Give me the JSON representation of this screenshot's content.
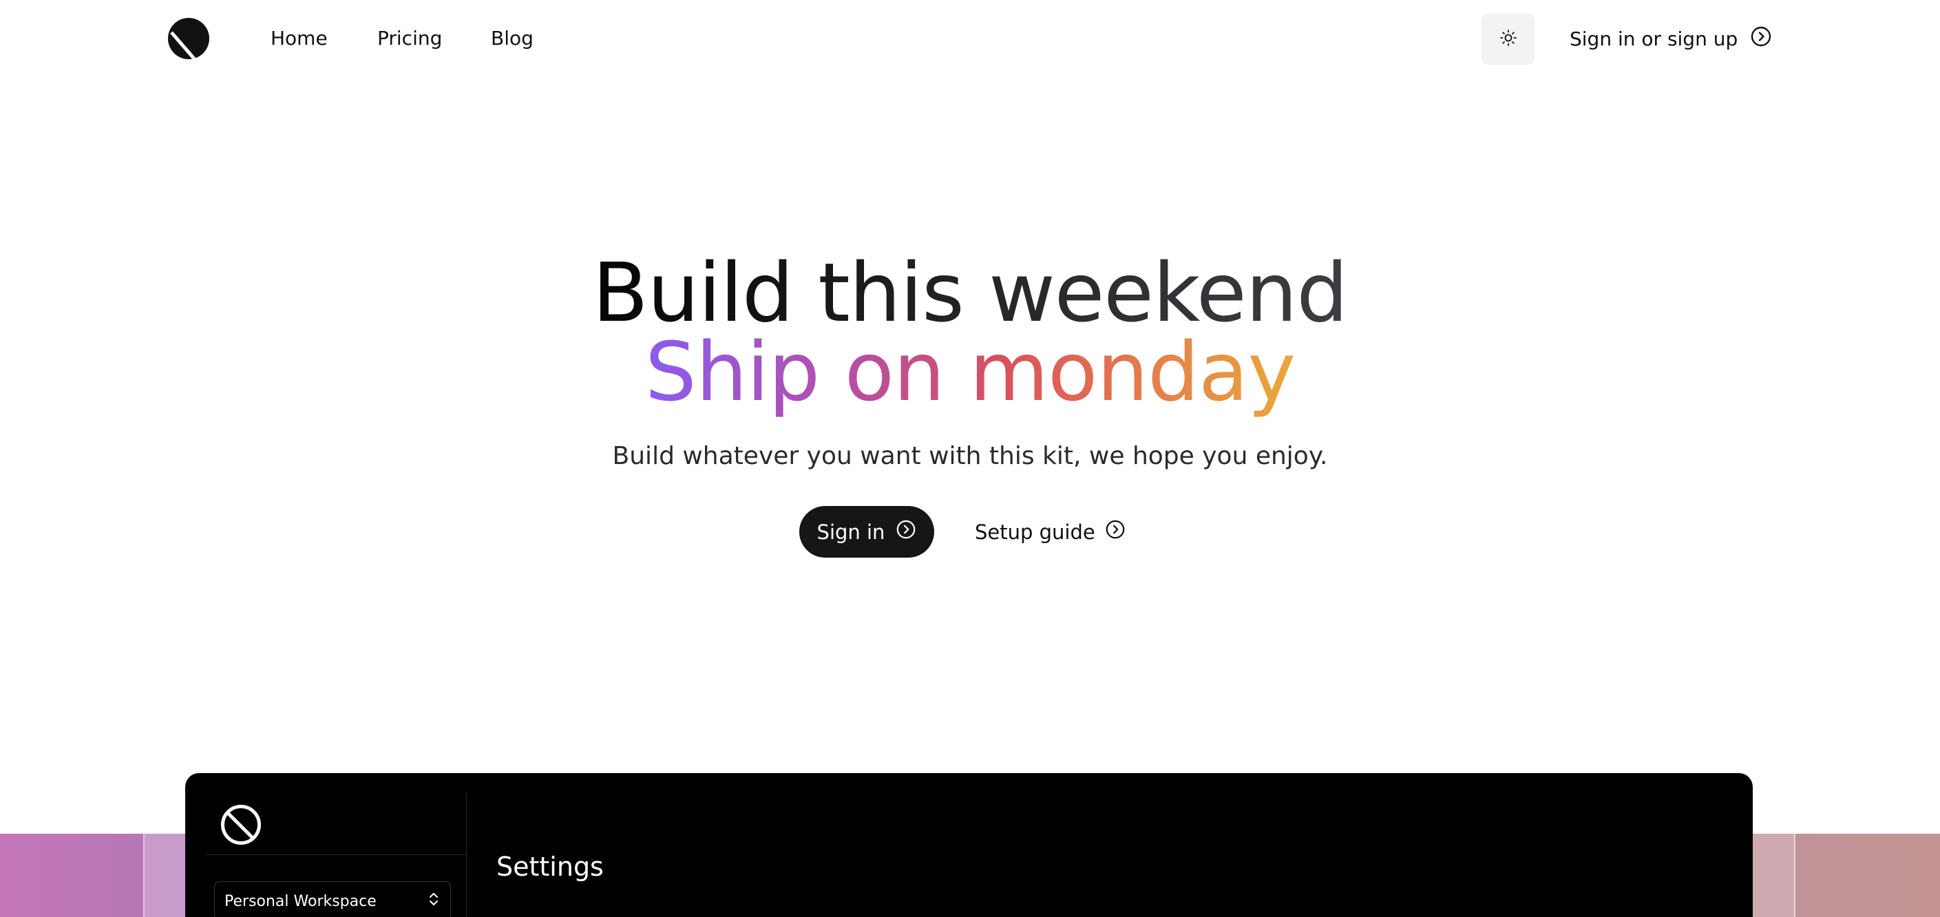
{
  "header": {
    "logo": {
      "icon": "half-moon-slash-logo-icon"
    },
    "nav": [
      {
        "label": "Home"
      },
      {
        "label": "Pricing"
      },
      {
        "label": "Blog"
      }
    ],
    "theme_toggle": {
      "icon": "sun-icon"
    },
    "auth_link": {
      "label": "Sign in or sign up",
      "icon": "chevron-right-circle-icon"
    }
  },
  "hero": {
    "line1": "Build this weekend",
    "line2": "Ship on monday",
    "subtitle": "Build whatever you want with this kit, we hope you enjoy.",
    "primary_cta": {
      "label": "Sign in",
      "icon": "chevron-right-circle-icon"
    },
    "secondary_cta": {
      "label": "Setup guide",
      "icon": "chevron-right-circle-icon"
    }
  },
  "preview": {
    "logo": {
      "icon": "circle-slash-logo-icon"
    },
    "workspace": {
      "value": "Personal Workspace",
      "icon": "chevrons-up-down-icon"
    },
    "page_title": "Settings"
  },
  "colors": {
    "accent_gradient": [
      "#8a5cf0",
      "#b34fa8",
      "#d9505e",
      "#e5834a",
      "#e9a93a"
    ],
    "primary_button": "#161616",
    "preview_background": "#000000"
  }
}
